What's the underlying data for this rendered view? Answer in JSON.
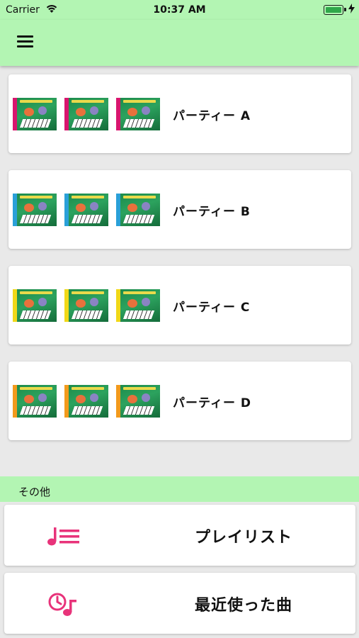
{
  "status_bar": {
    "carrier": "Carrier",
    "time": "10:37 AM",
    "battery_level": 1.0,
    "icons": [
      "wifi-icon",
      "battery-icon",
      "charging-bolt-icon"
    ]
  },
  "app_bar": {
    "menu_icon": "hamburger-menu-icon",
    "background": "#b3f5b3"
  },
  "parties": [
    {
      "label": "パーティー A",
      "accent": "#d8156e"
    },
    {
      "label": "パーティー B",
      "accent": "#2aa0d8"
    },
    {
      "label": "パーティー C",
      "accent": "#f0d818"
    },
    {
      "label": "パーティー D",
      "accent": "#f29a1c"
    }
  ],
  "other_section": {
    "header": "その他",
    "items": [
      {
        "label": "プレイリスト",
        "icon": "playlist-icon"
      },
      {
        "label": "最近使った曲",
        "icon": "recent-songs-icon"
      }
    ]
  },
  "colors": {
    "icon_pink": "#e8337a",
    "header_green": "#b3f5b3"
  }
}
